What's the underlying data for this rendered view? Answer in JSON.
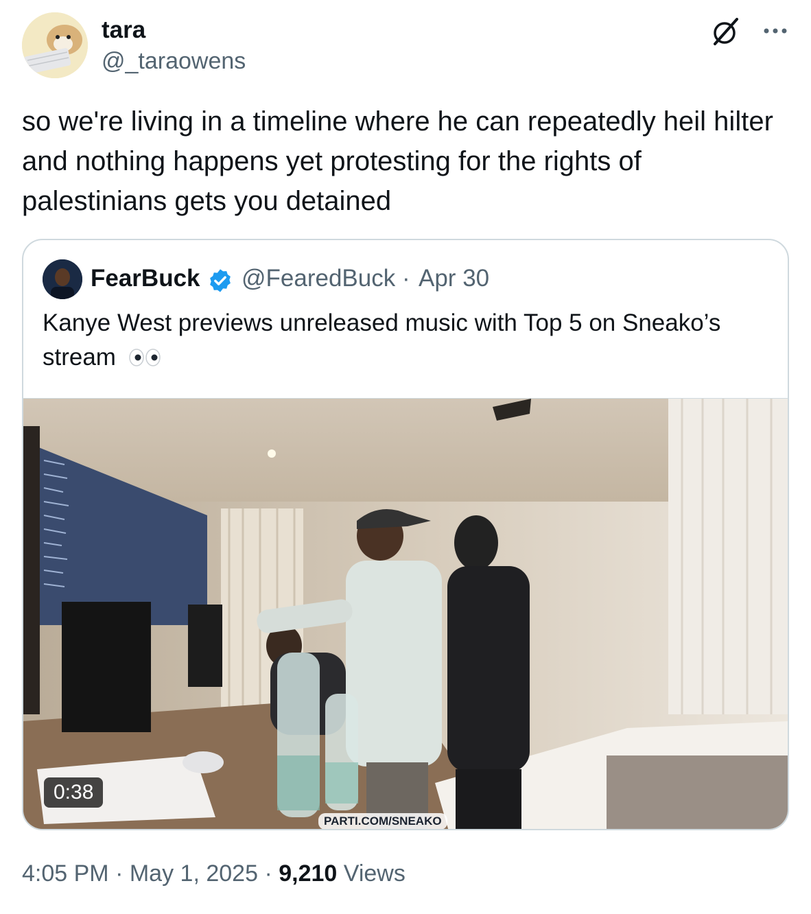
{
  "tweet": {
    "author_name": "tara",
    "author_handle": "@_taraowens",
    "text": "so we're living in a timeline where he can repeatedly heil hilter and nothing happens yet protesting for the rights of palestinians gets you detained",
    "time": "4:05 PM",
    "separator": "·",
    "date": "May 1, 2025",
    "views_count": "9,210",
    "views_label": "Views"
  },
  "quote": {
    "author_name": "FearBuck",
    "author_handle": "@FearedBuck",
    "separator": "·",
    "date": "Apr 30",
    "text": "Kanye West previews unreleased music with Top 5 on Sneako’s stream",
    "video_duration": "0:38",
    "watermark": "PARTI.COM/SNEAKO"
  },
  "icons": {
    "grok": "grok-icon",
    "more": "more-icon",
    "verified": "verified-badge-icon",
    "eyes": "eyes-emoji"
  },
  "colors": {
    "text": "#0f1419",
    "secondary": "#536471",
    "verified": "#1d9bf0",
    "border": "#cfd9de"
  }
}
